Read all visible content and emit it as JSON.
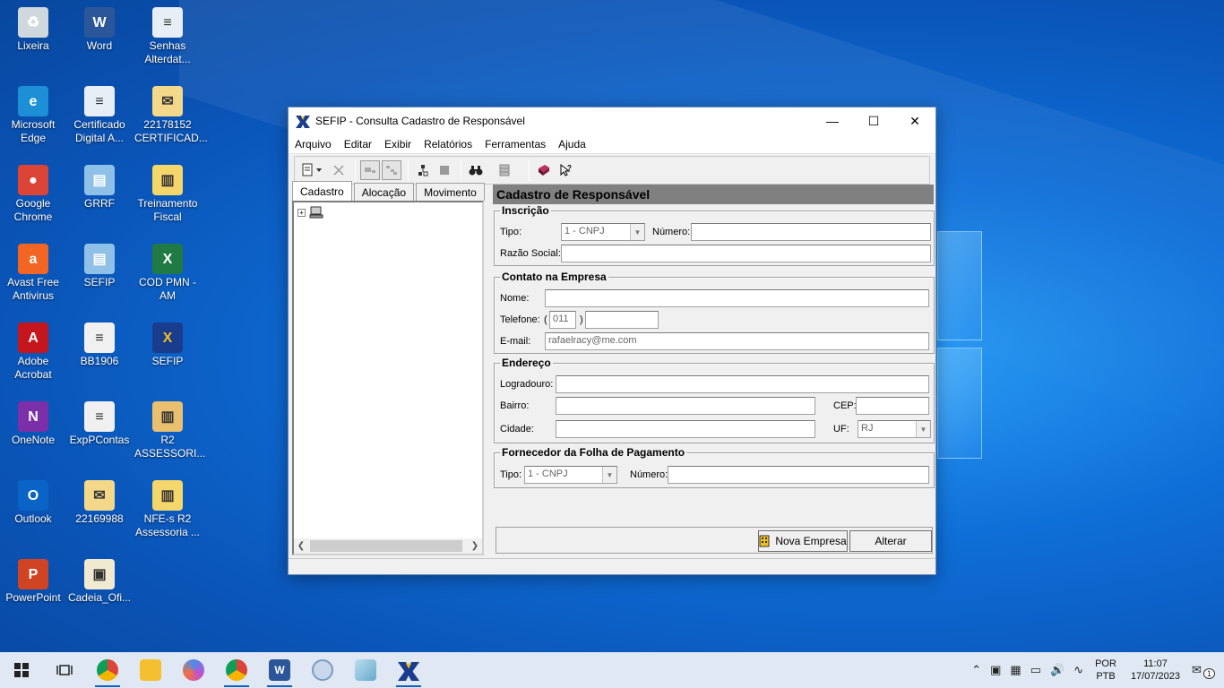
{
  "desktop": {
    "icons": [
      {
        "label": "Lixeira"
      },
      {
        "label": "Word"
      },
      {
        "label": "Senhas Alterdat..."
      },
      {
        "label": "Microsoft Edge"
      },
      {
        "label": "Certificado Digital A..."
      },
      {
        "label": "22178152 CERTIFICAD..."
      },
      {
        "label": "Google Chrome"
      },
      {
        "label": "GRRF"
      },
      {
        "label": "Treinamento Fiscal"
      },
      {
        "label": "Avast Free Antivirus"
      },
      {
        "label": "SEFIP"
      },
      {
        "label": "COD PMN - AM"
      },
      {
        "label": "Adobe Acrobat"
      },
      {
        "label": "BB1906"
      },
      {
        "label": "SEFIP"
      },
      {
        "label": "OneNote"
      },
      {
        "label": "ExpPContas"
      },
      {
        "label": "R2 ASSESSORI..."
      },
      {
        "label": "Outlook"
      },
      {
        "label": "22169988"
      },
      {
        "label": "NFE-s R2 Assessoria ..."
      },
      {
        "label": "PowerPoint"
      },
      {
        "label": "Cadeia_Ofi..."
      }
    ]
  },
  "window": {
    "title": "SEFIP - Consulta Cadastro de Responsável",
    "controls": {
      "minimize": "—",
      "maximize": "☐",
      "close": "✕"
    },
    "menu": [
      "Arquivo",
      "Editar",
      "Exibir",
      "Relatórios",
      "Ferramentas",
      "Ajuda"
    ]
  },
  "tabs": [
    "Cadastro",
    "Alocação",
    "Movimento"
  ],
  "panel": {
    "title": "Cadastro de Responsável",
    "inscricao": {
      "legend": "Inscrição",
      "tipo_label": "Tipo:",
      "tipo_value": "1 - CNPJ",
      "numero_label": "Número:",
      "numero_value": "",
      "razao_label": "Razão Social:",
      "razao_value": ""
    },
    "contato": {
      "legend": "Contato na Empresa",
      "nome_label": "Nome:",
      "nome_value": "",
      "telefone_label": "Telefone:",
      "paren_open": "(",
      "ddd_value": "011",
      "paren_close": ")",
      "telefone_value": "",
      "email_label": "E-mail:",
      "email_value": "rafaelracy@me.com"
    },
    "endereco": {
      "legend": "Endereço",
      "logradouro_label": "Logradouro:",
      "logradouro_value": "",
      "bairro_label": "Bairro:",
      "bairro_value": "",
      "cidade_label": "Cidade:",
      "cidade_value": "",
      "cep_label": "CEP:",
      "cep_value": "",
      "uf_label": "UF:",
      "uf_value": "RJ"
    },
    "fornecedor": {
      "legend": "Fornecedor da Folha de Pagamento",
      "tipo_label": "Tipo:",
      "tipo_value": "1 - CNPJ",
      "numero_label": "Número:",
      "numero_value": ""
    },
    "buttons": {
      "nova_empresa": "Nova Empresa",
      "alterar": "Alterar"
    }
  },
  "taskbar": {
    "lang_top": "POR",
    "lang_bottom": "PTB",
    "time": "11:07",
    "date": "17/07/2023",
    "notifications": "1"
  }
}
